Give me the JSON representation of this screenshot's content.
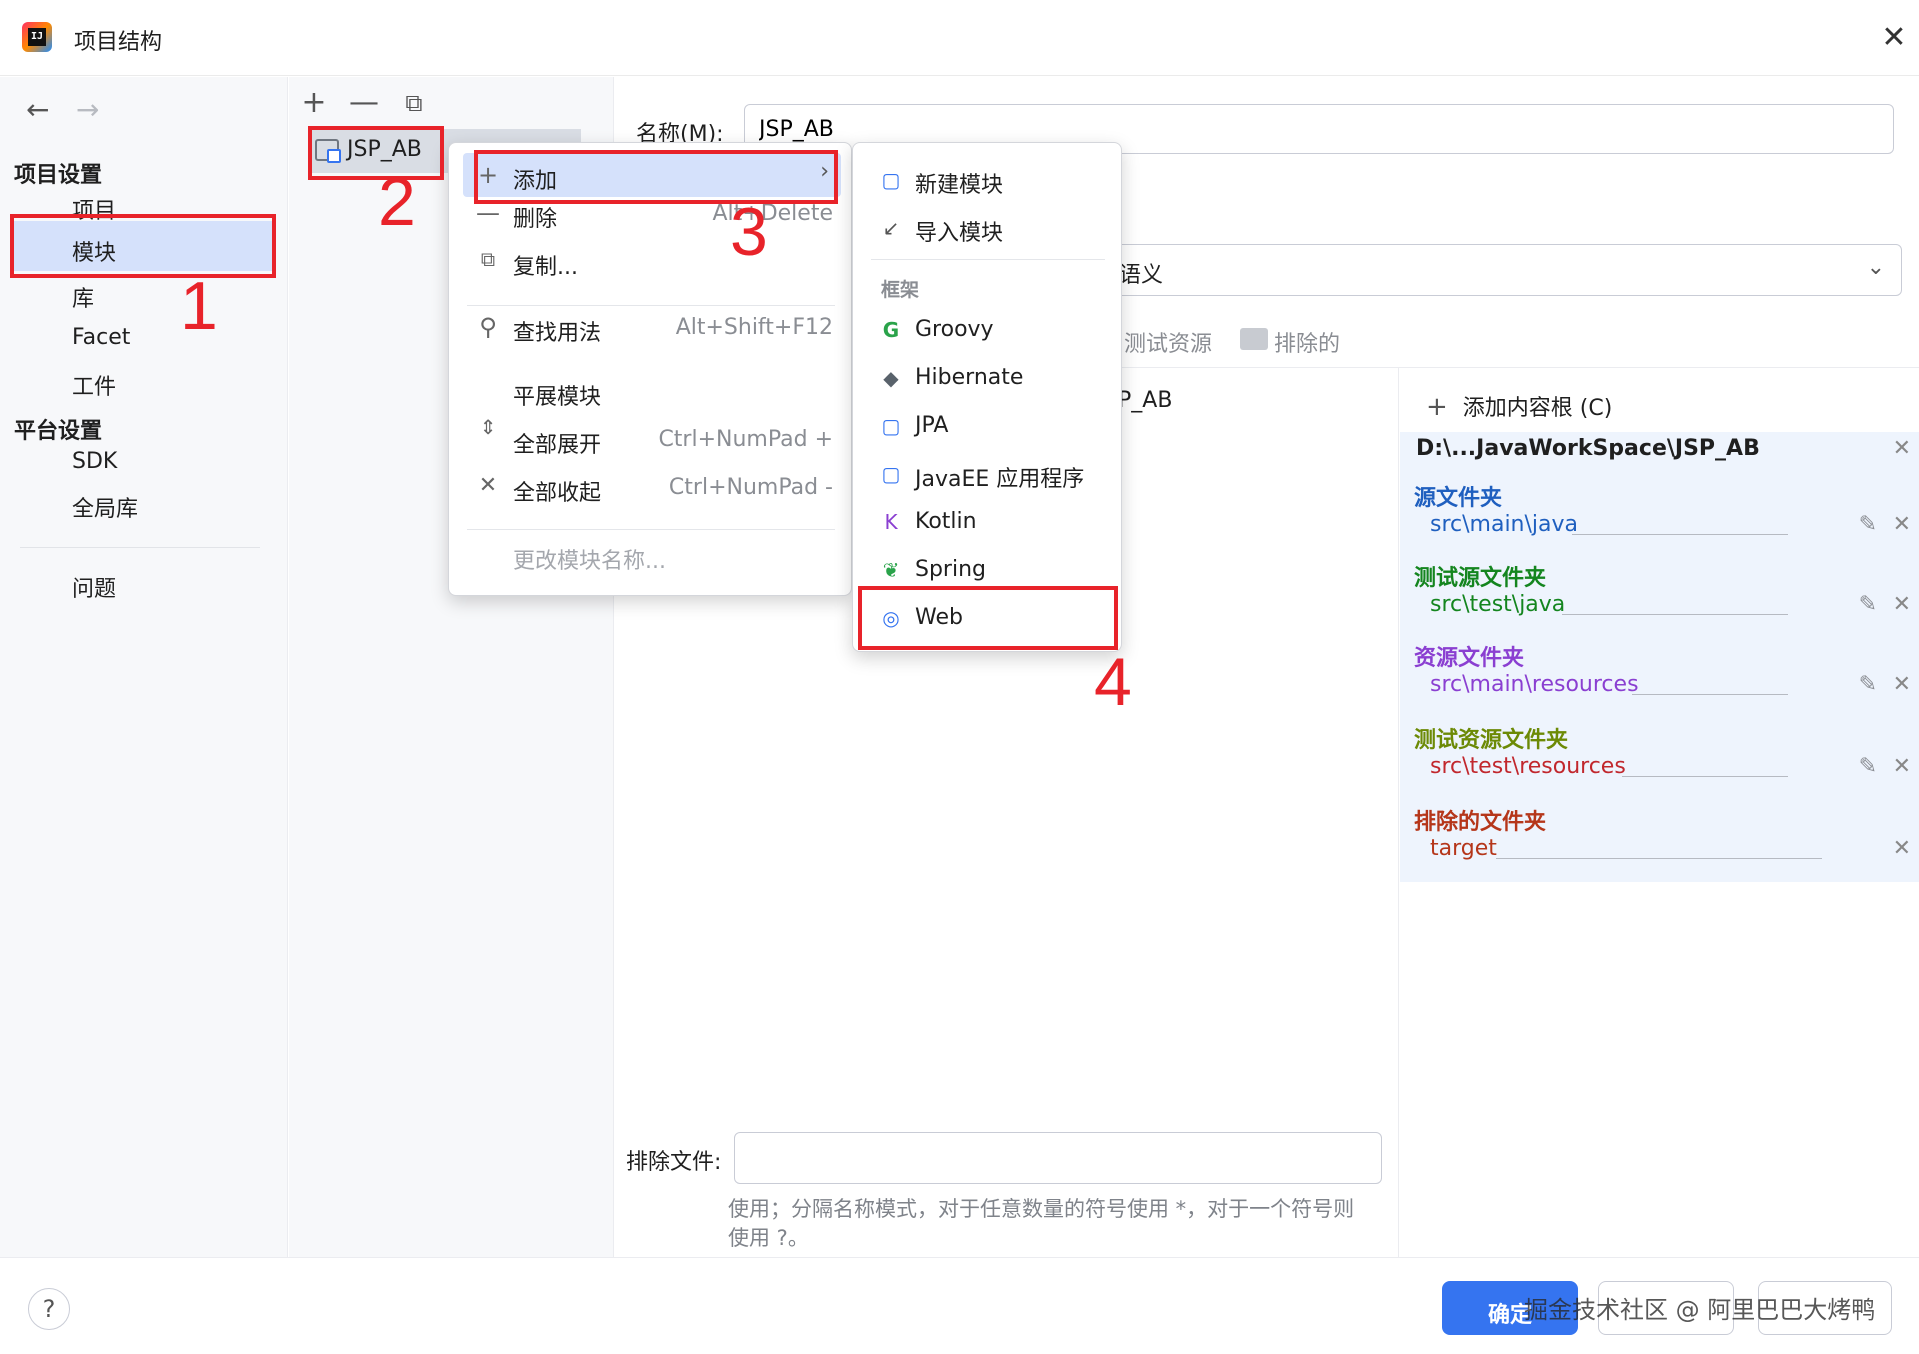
{
  "window": {
    "title": "项目结构",
    "close": "✕"
  },
  "nav": {
    "back": "←",
    "forward": "→",
    "project_settings": "项目设置",
    "project": "项目",
    "modules": "模块",
    "libraries": "库",
    "facets": "Facet",
    "artifacts": "工件",
    "platform_settings": "平台设置",
    "sdk": "SDK",
    "global_libraries": "全局库",
    "problems": "问题"
  },
  "module_list": {
    "add": "+",
    "remove": "—",
    "copy": "⧉",
    "module_name": "JSP_AB"
  },
  "main": {
    "name_label": "名称(M):",
    "name_value": "JSP_AB",
    "lang_level_fragment": "语义",
    "tab_test_resources": "测试资源",
    "tab_excluded": "排除的",
    "tree_root_fragment": "P_AB",
    "exclude_label": "排除文件:",
    "exclude_hint_1": "使用；分隔名称模式，对于任意数量的符号使用 *，对于一个符号则",
    "exclude_hint_2": "使用 ?。"
  },
  "content_roots": {
    "add_root": "添加内容根 (C)",
    "path": "D:\\...JavaWorkSpace\\JSP_AB",
    "sections": [
      {
        "heading": "源文件夹",
        "value": "src\\main\\java",
        "color": "#1f5fbf"
      },
      {
        "heading": "测试源文件夹",
        "value": "src\\test\\java",
        "color": "#14851f"
      },
      {
        "heading": "资源文件夹",
        "value": "src\\main\\resources",
        "color": "#8a3fd1"
      },
      {
        "heading": "测试资源文件夹",
        "value": "src\\test\\resources",
        "color": "#6c8a06",
        "value_color": "#c1272d"
      },
      {
        "heading": "排除的文件夹",
        "value": "target",
        "color": "#b5361a"
      }
    ]
  },
  "context_menu": {
    "add": "添加",
    "delete": "删除",
    "delete_shortcut": "Alt+Delete",
    "copy": "复制...",
    "find_usages": "查找用法",
    "find_usages_shortcut": "Alt+Shift+F12",
    "flatten_modules": "平展模块",
    "expand_all": "全部展开",
    "expand_all_shortcut": "Ctrl+NumPad +",
    "collapse_all": "全部收起",
    "collapse_all_shortcut": "Ctrl+NumPad -",
    "change_module_names": "更改模块名称..."
  },
  "submenu": {
    "new_module": "新建模块",
    "import_module": "导入模块",
    "frameworks_label": "框架",
    "frameworks": [
      "Groovy",
      "Hibernate",
      "JPA",
      "JavaEE 应用程序",
      "Kotlin",
      "Spring",
      "Web"
    ]
  },
  "footer": {
    "help": "?",
    "ok": "确定",
    "watermark": "掘金技术社区 @ 阿里巴巴大烤鸭"
  },
  "annotations": [
    "1",
    "2",
    "3",
    "4"
  ],
  "colors": {
    "accent": "#3574f0",
    "selection": "#d5e1fb",
    "annotation_red": "#e8232a"
  }
}
